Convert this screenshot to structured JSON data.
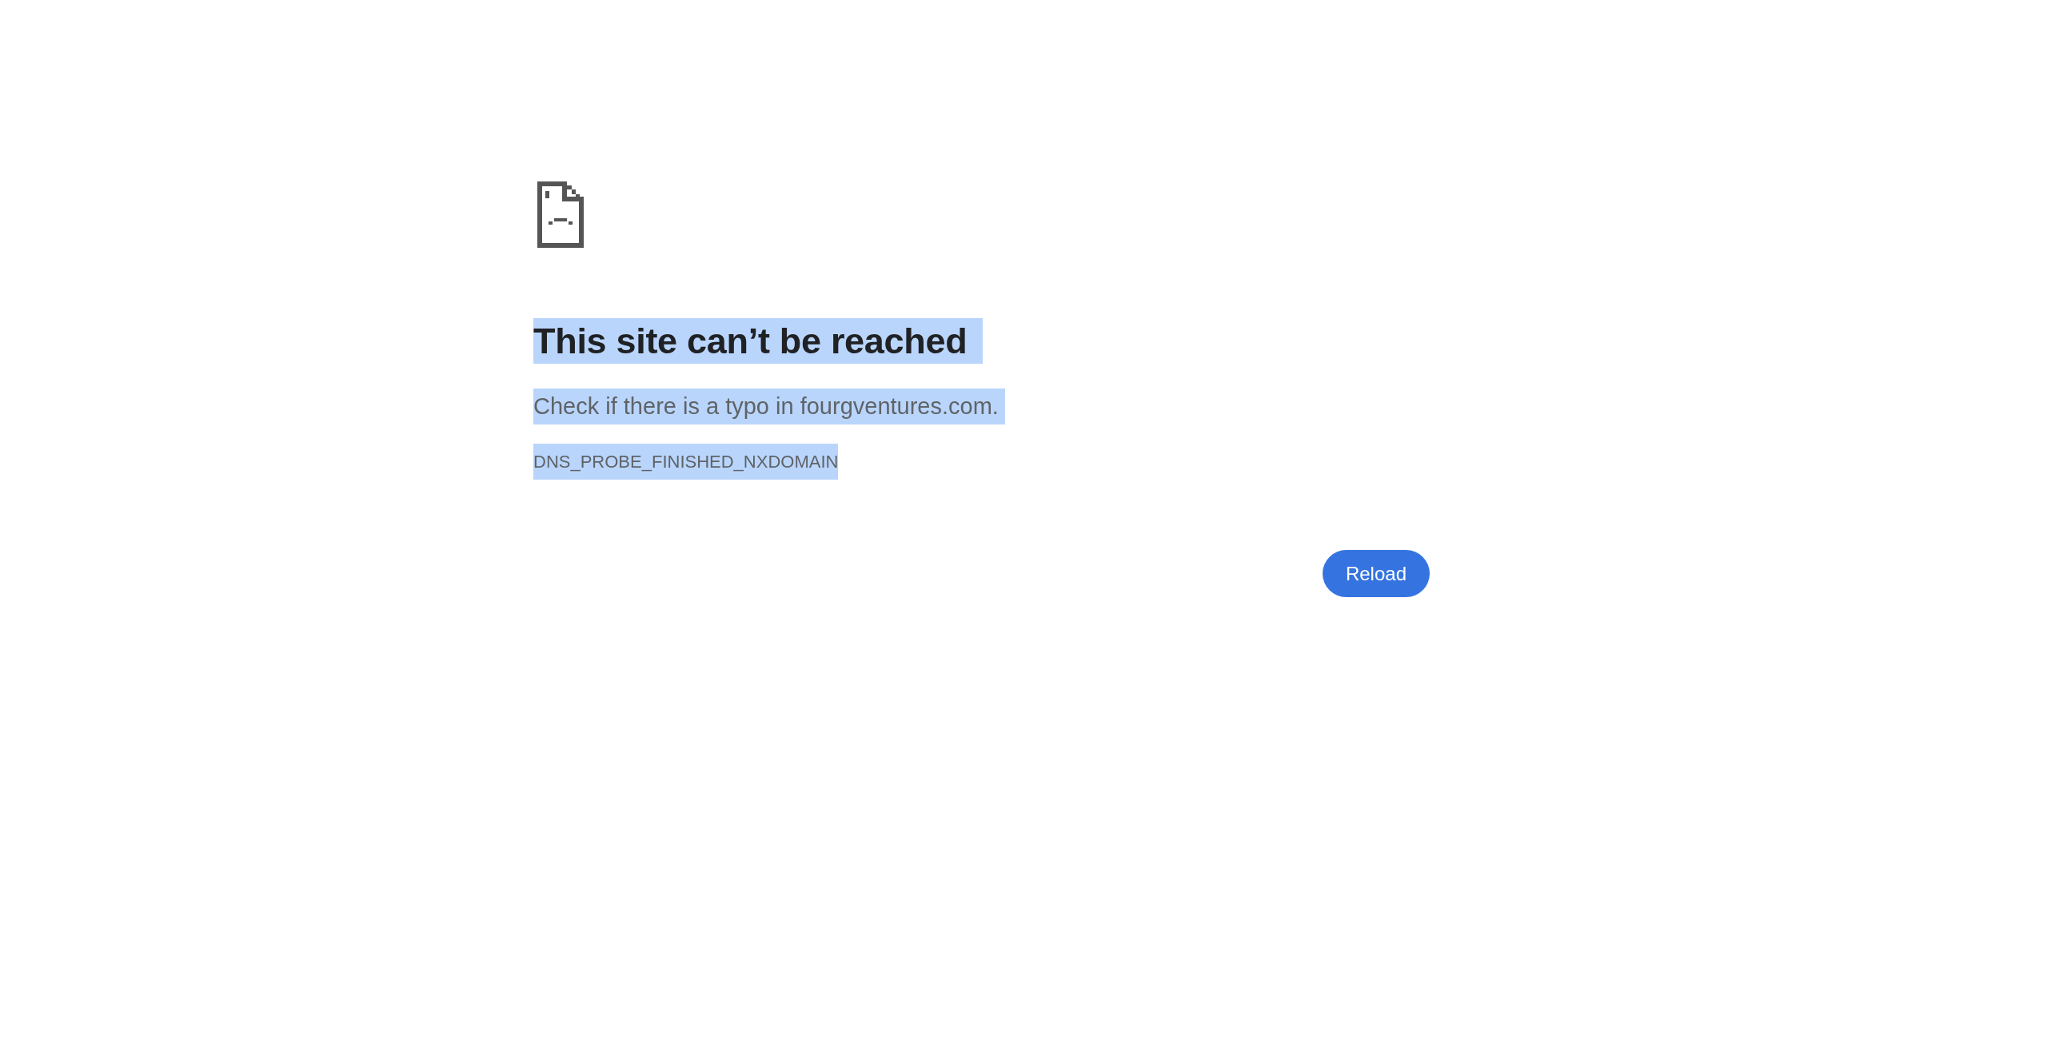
{
  "error": {
    "title": {
      "text": "This site can’t be reached",
      "highlighted": true
    },
    "message": {
      "text": "Check if there is a typo in fourgventures.com.",
      "highlighted": true
    },
    "code": {
      "text": "DNS_PROBE_FINISHED_NXDOMAIN",
      "highlighted": true
    }
  },
  "buttons": [
    {
      "label": "Reload"
    }
  ]
}
